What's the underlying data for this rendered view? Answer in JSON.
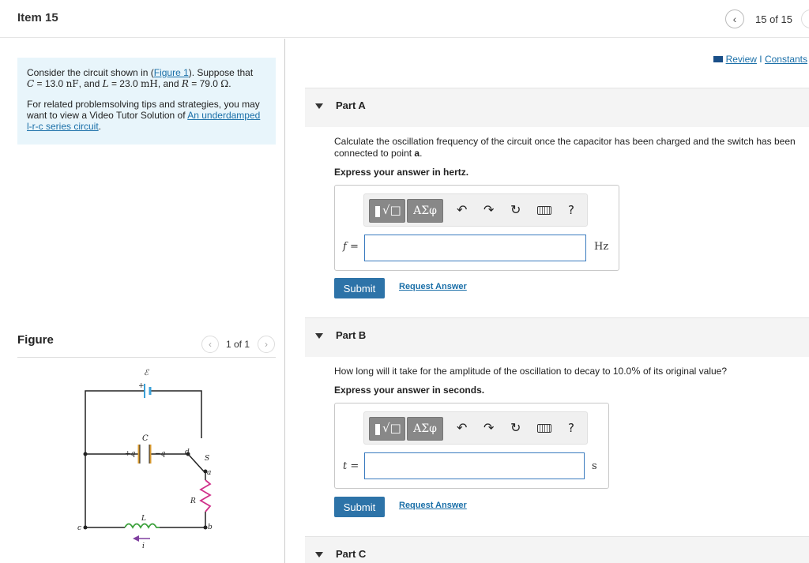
{
  "header": {
    "item_title": "Item 15",
    "prev_icon": "chevron-left-icon",
    "page_count": "15 of 15"
  },
  "problem": {
    "intro_before_link": "Consider the circuit shown in (",
    "figure_link": "Figure 1",
    "intro_after_link": "). Suppose that",
    "c_symbol": "C",
    "c_value": " = 13.0 ",
    "c_unit": "nF",
    "l_symbol": "L",
    "l_value": " = 23.0 ",
    "l_unit": "mH",
    "and": ", and ",
    "r_symbol": "R",
    "r_value": " = 79.0 ",
    "r_unit": "Ω",
    "tips_text": "For related problemsolving tips and strategies, you may want to view a Video Tutor Solution of ",
    "tips_link": "An underdamped l-r-c series circuit",
    "tips_end": "."
  },
  "figure": {
    "label": "Figure",
    "count": "1 of 1",
    "circuit_labels": {
      "emf": "ℰ",
      "plus": "+",
      "capacitor": "C",
      "plus_q": "+q",
      "minus_q": "−q",
      "switch": "S",
      "d": "d",
      "a": "a",
      "resistor": "R",
      "inductor": "L",
      "b": "b",
      "c": "c",
      "current": "i"
    }
  },
  "review": {
    "review_label": "Review",
    "separator": " I ",
    "constants_label": "Constants"
  },
  "parts": [
    {
      "title": "Part A",
      "question": "Calculate the oscillation frequency of the circuit once the capacitor has been charged and the switch has been connected to point ",
      "question_bold": "a",
      "question_end": ".",
      "instruction": "Express your answer in hertz.",
      "answer_label": "f =",
      "unit": "Hz",
      "submit": "Submit",
      "request": "Request Answer"
    },
    {
      "title": "Part B",
      "question": "How long will it take for the amplitude of the oscillation to decay to 10.0",
      "question_pct": "%",
      "question_end": " of its original value?",
      "instruction": "Express your answer in seconds.",
      "answer_label": "t =",
      "unit": "s",
      "submit": "Submit",
      "request": "Request Answer"
    },
    {
      "title": "Part C"
    }
  ],
  "toolbar": {
    "templates_icon": "templates-radical-icon",
    "radical": "√□",
    "greek": "ΑΣφ",
    "undo_icon": "undo-icon",
    "redo_icon": "redo-icon",
    "reset_icon": "reset-icon",
    "keyboard_icon": "keyboard-icon",
    "help": "?"
  },
  "colors": {
    "accent": "#2d73a8",
    "link": "#1a6fa8",
    "problem_bg": "#e8f5fb",
    "input_border": "#3a7bbf",
    "emf_blue": "#3aa0d8",
    "inductor_green": "#3aa03a",
    "resistor_pink": "#d0308a",
    "capacitor_orange": "#d89a30",
    "arrow_purple": "#8040a0"
  }
}
